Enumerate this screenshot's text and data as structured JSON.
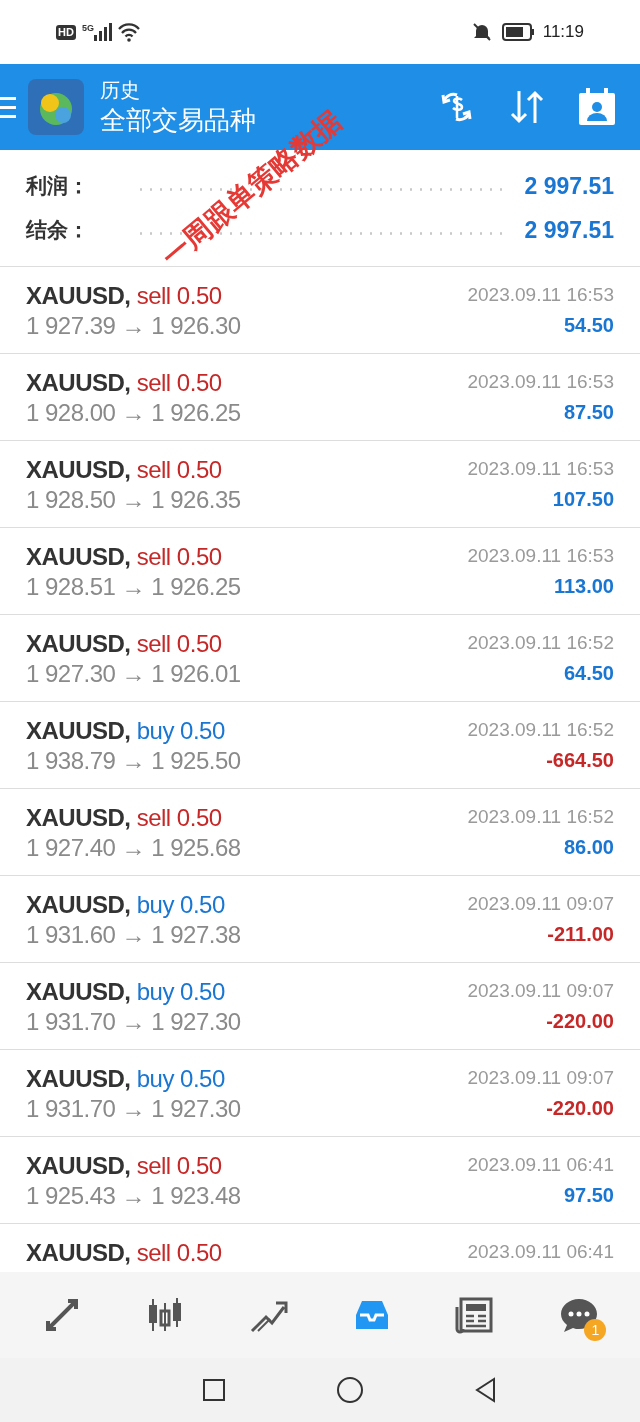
{
  "status_bar": {
    "hd": "HD",
    "network": "5G",
    "time": "11:19"
  },
  "header": {
    "title": "历史",
    "subtitle": "全部交易品种"
  },
  "annotation": "一周跟单策略数据",
  "summary": [
    {
      "label": "利润：",
      "value": "2 997.51"
    },
    {
      "label": "结余：",
      "value": "2 997.51"
    }
  ],
  "trades": [
    {
      "symbol": "XAUUSD,",
      "type": "sell",
      "volume": "0.50",
      "prices": "1 927.39 → 1 926.30",
      "time": "2023.09.11 16:53",
      "profit": "54.50",
      "loss": false
    },
    {
      "symbol": "XAUUSD,",
      "type": "sell",
      "volume": "0.50",
      "prices": "1 928.00 → 1 926.25",
      "time": "2023.09.11 16:53",
      "profit": "87.50",
      "loss": false
    },
    {
      "symbol": "XAUUSD,",
      "type": "sell",
      "volume": "0.50",
      "prices": "1 928.50 → 1 926.35",
      "time": "2023.09.11 16:53",
      "profit": "107.50",
      "loss": false
    },
    {
      "symbol": "XAUUSD,",
      "type": "sell",
      "volume": "0.50",
      "prices": "1 928.51 → 1 926.25",
      "time": "2023.09.11 16:53",
      "profit": "113.00",
      "loss": false
    },
    {
      "symbol": "XAUUSD,",
      "type": "sell",
      "volume": "0.50",
      "prices": "1 927.30 → 1 926.01",
      "time": "2023.09.11 16:52",
      "profit": "64.50",
      "loss": false
    },
    {
      "symbol": "XAUUSD,",
      "type": "buy",
      "volume": "0.50",
      "prices": "1 938.79 → 1 925.50",
      "time": "2023.09.11 16:52",
      "profit": "-664.50",
      "loss": true
    },
    {
      "symbol": "XAUUSD,",
      "type": "sell",
      "volume": "0.50",
      "prices": "1 927.40 → 1 925.68",
      "time": "2023.09.11 16:52",
      "profit": "86.00",
      "loss": false
    },
    {
      "symbol": "XAUUSD,",
      "type": "buy",
      "volume": "0.50",
      "prices": "1 931.60 → 1 927.38",
      "time": "2023.09.11 09:07",
      "profit": "-211.00",
      "loss": true
    },
    {
      "symbol": "XAUUSD,",
      "type": "buy",
      "volume": "0.50",
      "prices": "1 931.70 → 1 927.30",
      "time": "2023.09.11 09:07",
      "profit": "-220.00",
      "loss": true
    },
    {
      "symbol": "XAUUSD,",
      "type": "buy",
      "volume": "0.50",
      "prices": "1 931.70 → 1 927.30",
      "time": "2023.09.11 09:07",
      "profit": "-220.00",
      "loss": true
    },
    {
      "symbol": "XAUUSD,",
      "type": "sell",
      "volume": "0.50",
      "prices": "1 925.43 → 1 923.48",
      "time": "2023.09.11 06:41",
      "profit": "97.50",
      "loss": false
    },
    {
      "symbol": "XAUUSD,",
      "type": "sell",
      "volume": "0.50",
      "time": "2023.09.11 06:41"
    }
  ],
  "bottom_nav": [
    {
      "kind": "trade",
      "selected": false
    },
    {
      "kind": "chart",
      "selected": false
    },
    {
      "kind": "quotes",
      "selected": false
    },
    {
      "kind": "history",
      "selected": true
    },
    {
      "kind": "news",
      "selected": false
    },
    {
      "kind": "chat",
      "selected": false,
      "badge": "1"
    }
  ]
}
